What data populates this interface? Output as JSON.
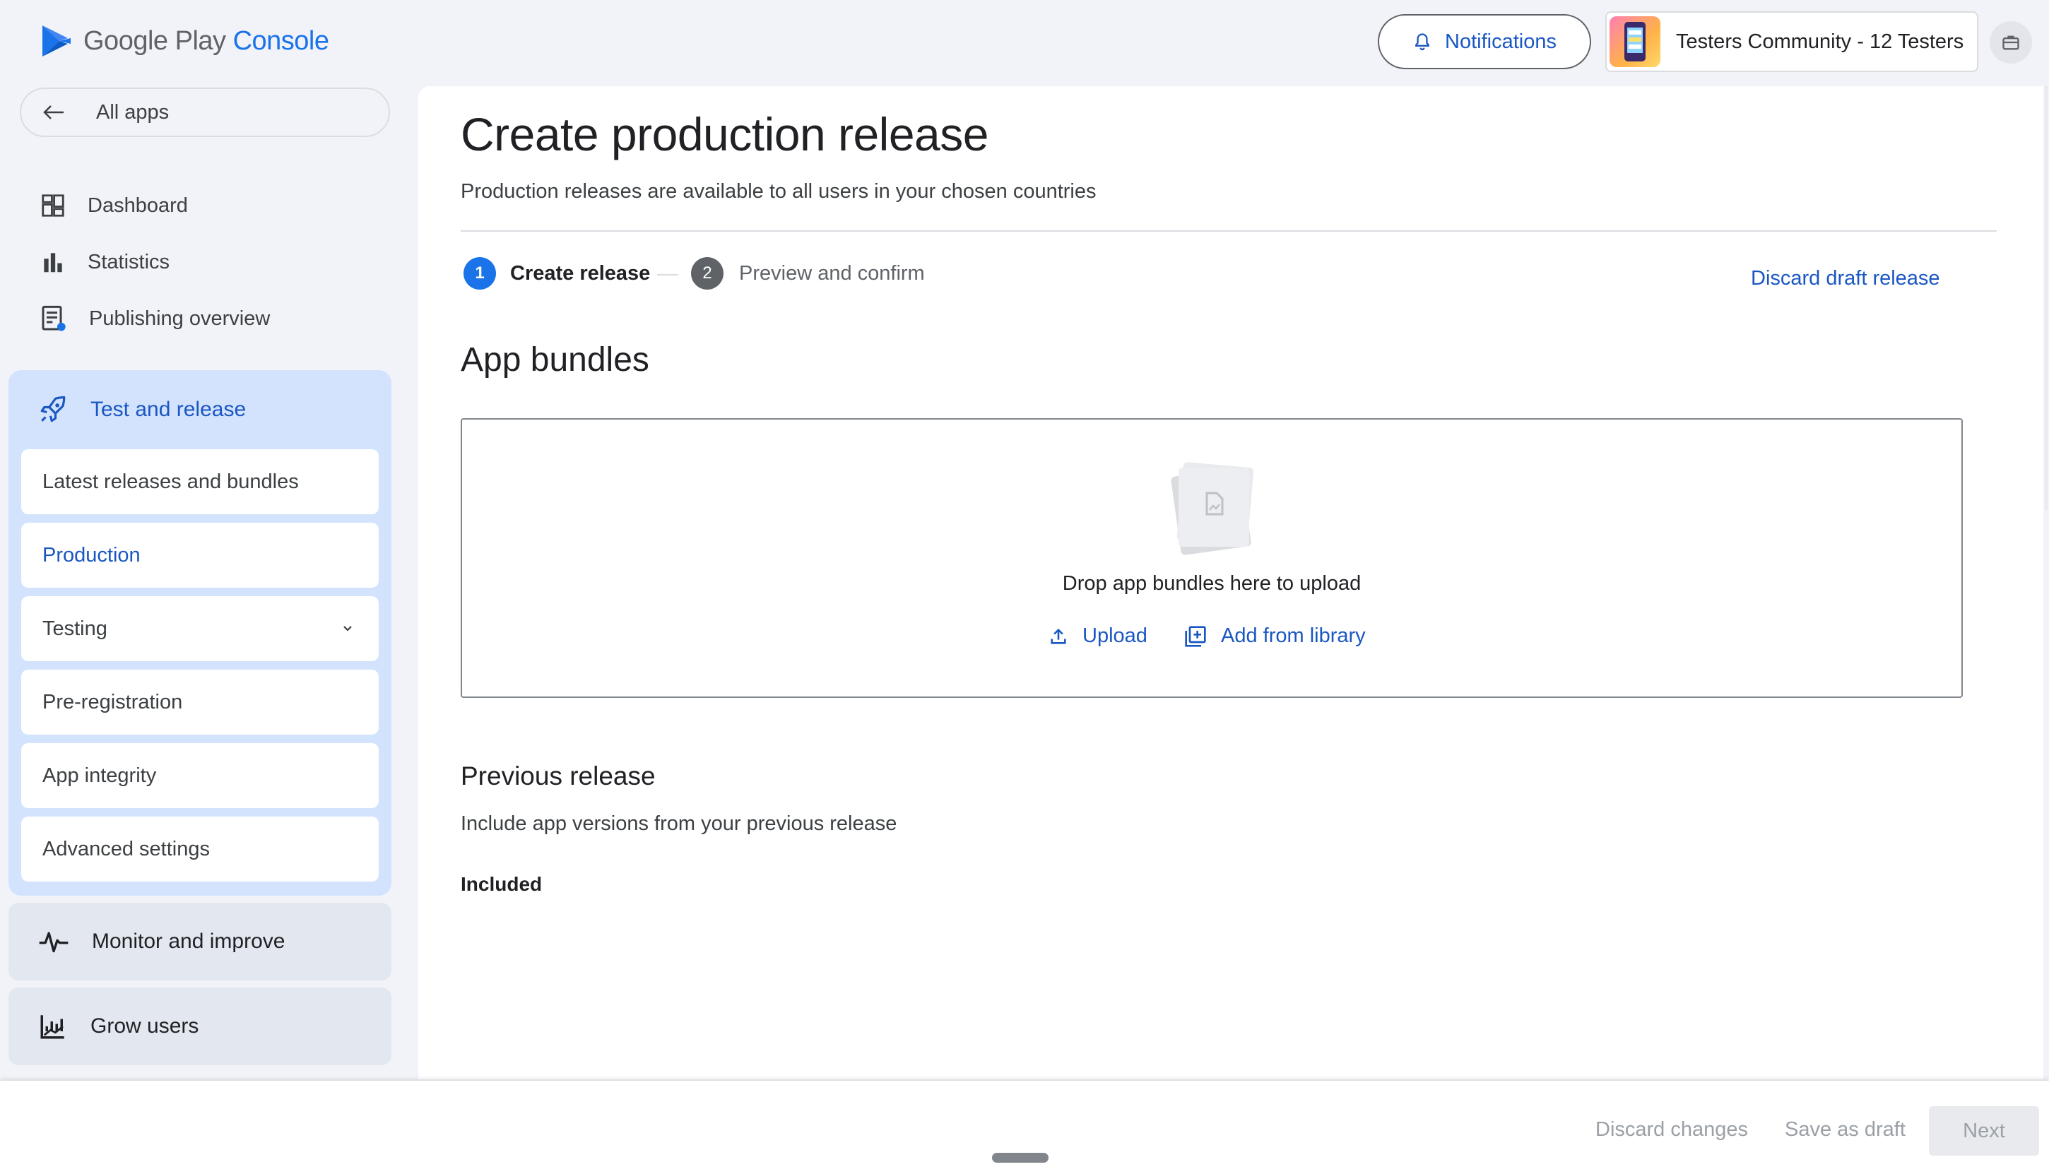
{
  "header": {
    "logo_google_play": "Google Play",
    "logo_console": "Console",
    "notifications_label": "Notifications",
    "account_name": "Testers Community - 12 Testers"
  },
  "sidebar": {
    "all_apps_label": "All apps",
    "items": [
      {
        "label": "Dashboard",
        "icon": "dashboard-icon"
      },
      {
        "label": "Statistics",
        "icon": "bar-chart-icon"
      },
      {
        "label": "Publishing overview",
        "icon": "publishing-overview-icon"
      }
    ],
    "test_and_release": {
      "label": "Test and release",
      "icon": "rocket-icon",
      "subitems": [
        {
          "label": "Latest releases and bundles"
        },
        {
          "label": "Production",
          "active": true
        },
        {
          "label": "Testing",
          "expandable": true
        },
        {
          "label": "Pre-registration"
        },
        {
          "label": "App integrity"
        },
        {
          "label": "Advanced settings"
        }
      ]
    },
    "monitor_label": "Monitor and improve",
    "grow_label": "Grow users"
  },
  "main": {
    "title": "Create production release",
    "subtitle": "Production releases are available to all users in your chosen countries",
    "steps": [
      {
        "number": "1",
        "label": "Create release",
        "active": true
      },
      {
        "number": "2",
        "label": "Preview and confirm",
        "active": false
      }
    ],
    "discard_draft_label": "Discard draft release",
    "bundles_title": "App bundles",
    "drop_text": "Drop app bundles here to upload",
    "upload_label": "Upload",
    "add_library_label": "Add from library",
    "previous_release_title": "Previous release",
    "previous_release_sub": "Include app versions from your previous release",
    "included_label": "Included"
  },
  "footer": {
    "discard_changes_label": "Discard changes",
    "save_draft_label": "Save as draft",
    "next_label": "Next"
  },
  "colors": {
    "accent": "#1a73e8",
    "active_nav_bg": "#d3e3fd",
    "page_bg": "#f1f3f8"
  }
}
